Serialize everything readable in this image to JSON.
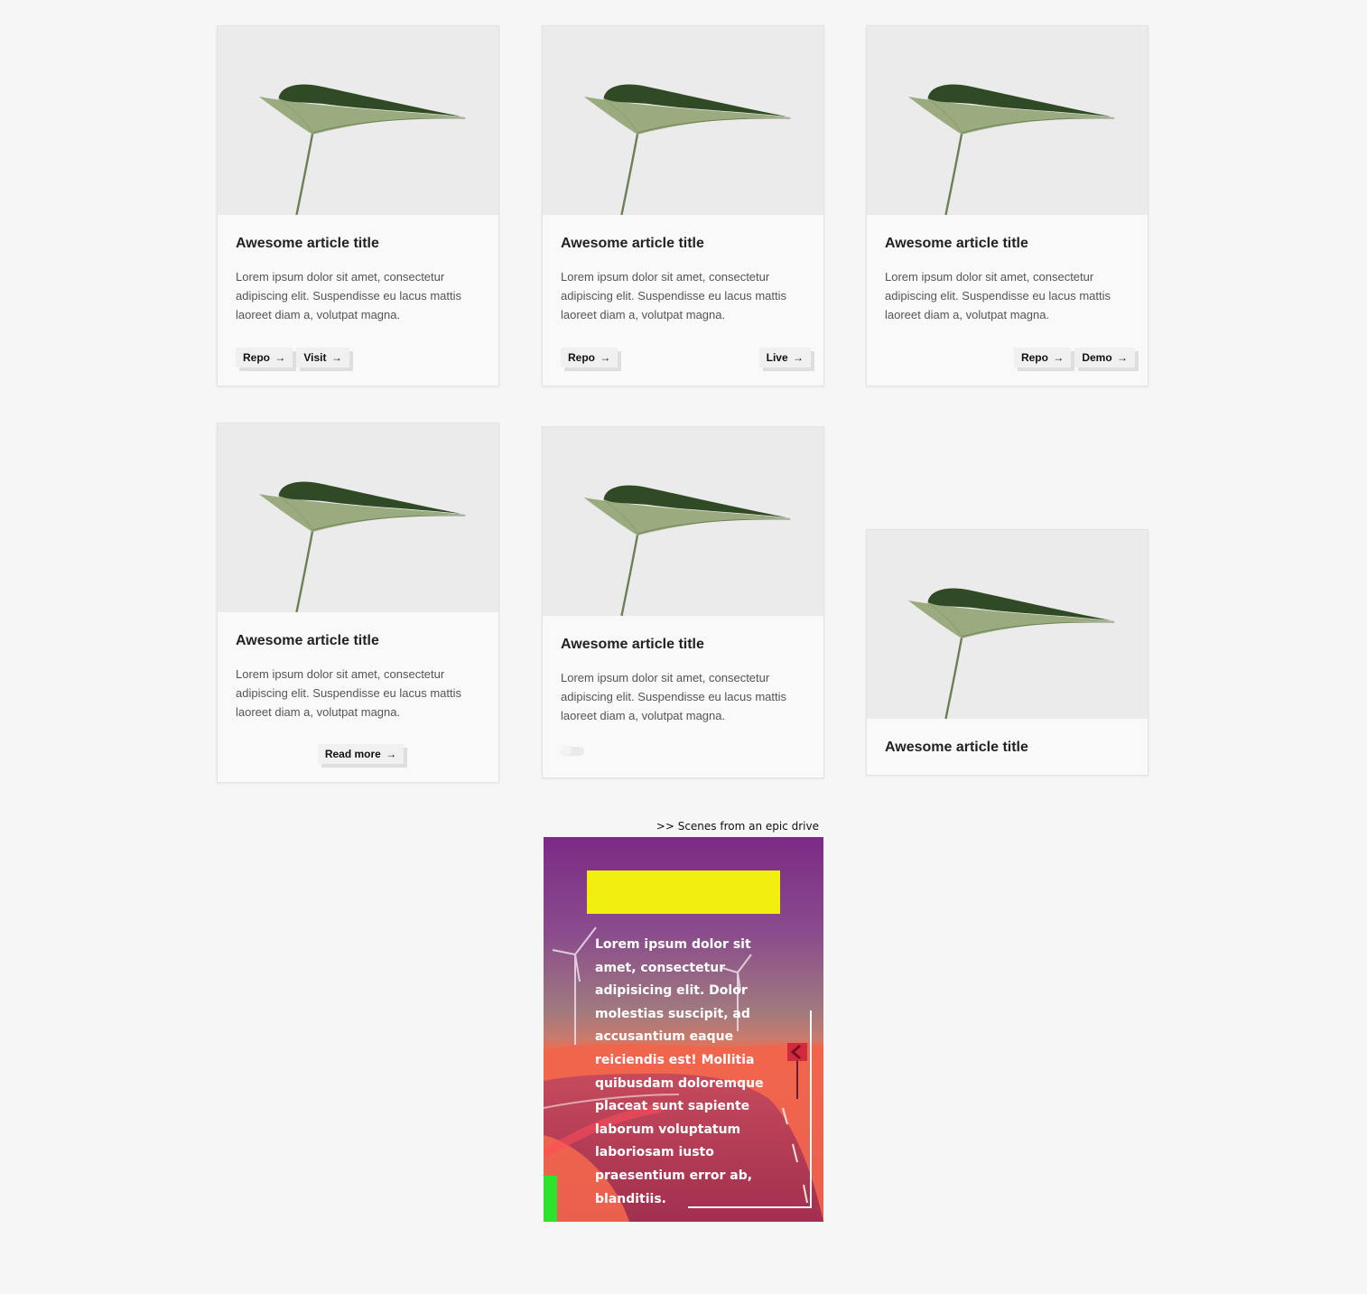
{
  "cards": [
    {
      "title": "Awesome article title",
      "text": "Lorem ipsum dolor sit amet, consectetur adipiscing elit. Suspendisse eu lacus mattis laoreet diam a, volutpat magna.",
      "buttons": [
        {
          "label": "Repo",
          "arrow": "→"
        },
        {
          "label": "Visit",
          "arrow": "→"
        }
      ]
    },
    {
      "title": "Awesome article title",
      "text": "Lorem ipsum dolor sit amet, consectetur adipiscing elit. Suspendisse eu lacus mattis laoreet diam a, volutpat magna.",
      "buttons": [
        {
          "label": "Repo",
          "arrow": "→"
        },
        {
          "label": "Live",
          "arrow": "→"
        }
      ]
    },
    {
      "title": "Awesome article title",
      "text": "Lorem ipsum dolor sit amet, consectetur adipiscing elit. Suspendisse eu lacus mattis laoreet diam a, volutpat magna.",
      "buttons": [
        {
          "label": "Repo",
          "arrow": "→"
        },
        {
          "label": "Demo",
          "arrow": "→"
        }
      ]
    },
    {
      "title": "Awesome article title",
      "text": "Lorem ipsum dolor sit amet, consectetur adipiscing elit. Suspendisse eu lacus mattis laoreet diam a, volutpat magna.",
      "buttons": [
        {
          "label": "Read more",
          "arrow": "→"
        }
      ]
    },
    {
      "title": "Awesome article title",
      "text": "Lorem ipsum dolor sit amet, consectetur adipiscing elit. Suspendisse eu lacus mattis laoreet diam a, volutpat magna."
    },
    {
      "title": "Awesome article title"
    }
  ],
  "scene": {
    "caption": ">> Scenes from an epic drive",
    "text": "Lorem ipsum dolor sit amet, consectetur adipisicing elit. Dolor molestias suscipit, ad accusantium eaque reiciendis est! Mollitia quibusdam doloremque placeat sunt sapiente laborum voluptatum laboriosam iusto praesentium error ab, blanditiis.",
    "colors": {
      "highlight_bar": "#f2ee0e",
      "accent_green": "#2fe22b",
      "sky_top": "#7b2b86",
      "road": "#b23452"
    }
  }
}
